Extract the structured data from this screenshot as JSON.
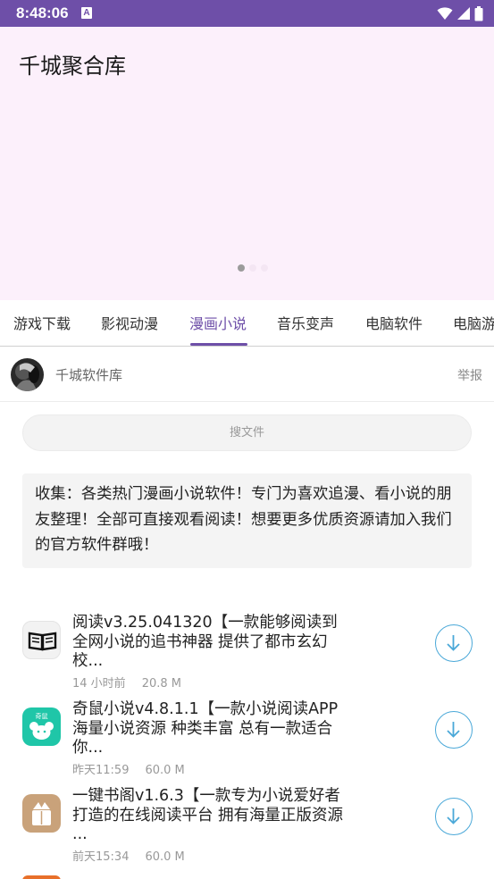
{
  "status_bar": {
    "time": "8:48:06",
    "notification_icon": "A"
  },
  "banner": {
    "title": "千城聚合库",
    "slide_count": 3,
    "active_slide": 1
  },
  "tabs": [
    {
      "label": "游戏下载"
    },
    {
      "label": "影视动漫"
    },
    {
      "label": "漫画小说",
      "active": true
    },
    {
      "label": "音乐变声"
    },
    {
      "label": "电脑软件"
    },
    {
      "label": "电脑游"
    }
  ],
  "owner": {
    "name": "千城软件库",
    "report_label": "举报"
  },
  "search": {
    "placeholder": "搜文件"
  },
  "description": "收集：各类热门漫画小说软件！专门为喜欢追漫、看小说的朋友整理！全部可直接观看阅读！想要更多优质资源请加入我们的官方软件群哦！",
  "files": [
    {
      "title": "阅读v3.25.041320【一款能够阅读到全网小说的追书神器 提供了都市玄幻 校...",
      "time": "14 小时前",
      "size": "20.8 M",
      "icon": "book-icon",
      "icon_bg": "#f2f2f2"
    },
    {
      "title": "奇鼠小说v4.8.1.1【一款小说阅读APP 海量小说资源 种类丰富 总有一款适合你...",
      "time": "昨天11:59",
      "size": "60.0 M",
      "icon": "mouse-icon",
      "icon_bg": "#1fc6a8"
    },
    {
      "title": "一键书阁v1.6.3【一款专为小说爱好者打造的在线阅读平台 拥有海量正版资源 ...",
      "time": "前天15:34",
      "size": "60.0 M",
      "icon": "reader-icon",
      "icon_bg": "#c9a27a"
    }
  ],
  "colors": {
    "accent": "#6e4fa8",
    "banner_bg": "#fcf0fb",
    "download": "#4aa8d8"
  }
}
